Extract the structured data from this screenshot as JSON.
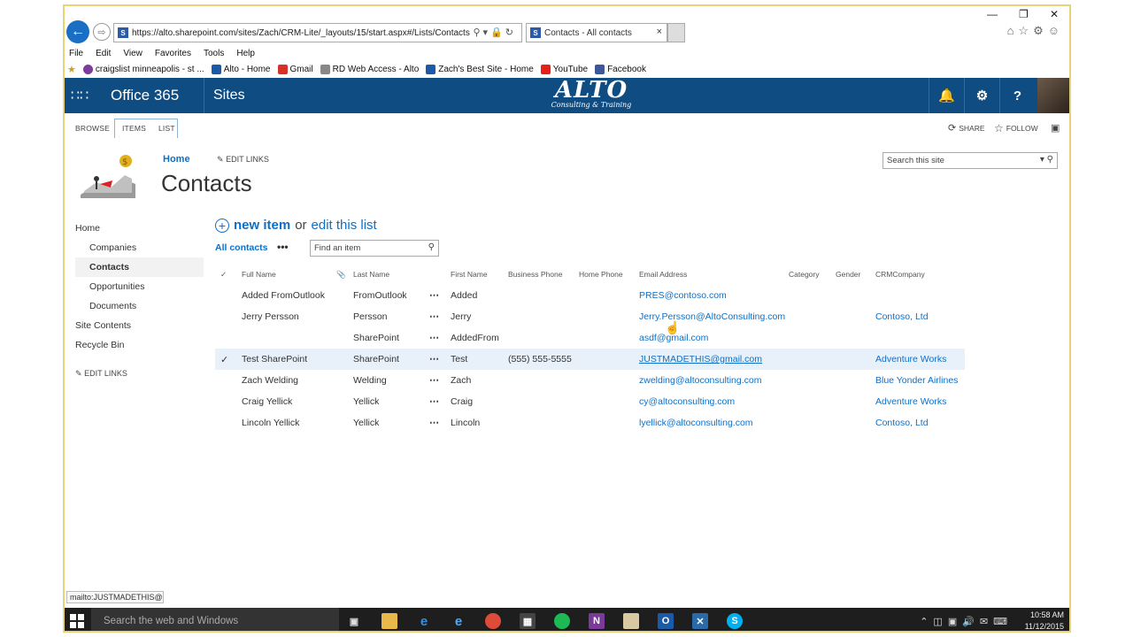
{
  "browser": {
    "url": "https://alto.sharepoint.com/sites/Zach/CRM-Lite/_layouts/15/start.aspx#/Lists/Contacts",
    "tab_title": "Contacts - All contacts",
    "tab_close": "×",
    "menu": [
      "File",
      "Edit",
      "View",
      "Favorites",
      "Tools",
      "Help"
    ],
    "favorites": [
      {
        "label": "craigslist minneapolis - st ...",
        "color": "#7a3e9a"
      },
      {
        "label": "Alto - Home",
        "color": "#1a5aa8"
      },
      {
        "label": "Gmail",
        "color": "#d93025"
      },
      {
        "label": "RD Web Access - Alto",
        "color": "#666666"
      },
      {
        "label": "Zach's Best Site - Home",
        "color": "#1a5aa8"
      },
      {
        "label": "YouTube",
        "color": "#e62117"
      },
      {
        "label": "Facebook",
        "color": "#3b5998"
      }
    ],
    "status_text": "mailto:JUSTMADETHIS@g"
  },
  "suitebar": {
    "brand": "Office 365",
    "sites": "Sites",
    "logo_main": "ALTO",
    "logo_sub": "Consulting & Training",
    "icons": [
      "bell-icon",
      "gear-icon",
      "help-icon"
    ],
    "help_glyph": "?"
  },
  "ribbon": {
    "tabs": [
      "BROWSE",
      "ITEMS",
      "LIST"
    ],
    "share": "SHARE",
    "follow": "FOLLOW"
  },
  "page": {
    "home_link": "Home",
    "edit_links": "EDIT LINKS",
    "title": "Contacts",
    "search_placeholder": "Search this site"
  },
  "leftnav": {
    "home": "Home",
    "companies": "Companies",
    "contacts": "Contacts",
    "opportunities": "Opportunities",
    "documents": "Documents",
    "site_contents": "Site Contents",
    "recycle_bin": "Recycle Bin",
    "edit_links": "EDIT LINKS"
  },
  "list": {
    "new_item": "new item",
    "or": "or",
    "edit_list": "edit this list",
    "view": "All contacts",
    "view_menu": "•••",
    "find_placeholder": "Find an item",
    "columns": [
      "Full Name",
      "Last Name",
      "First Name",
      "Business Phone",
      "Home Phone",
      "Email Address",
      "Category",
      "Gender",
      "CRMCompany"
    ],
    "rows": [
      {
        "full": "Added FromOutlook",
        "last": "FromOutlook",
        "first": "Added",
        "bphone": "",
        "email": "PRES@contoso.com",
        "company": "",
        "selected": false
      },
      {
        "full": "Jerry Persson",
        "last": "Persson",
        "first": "Jerry",
        "bphone": "",
        "email": "Jerry.Persson@AltoConsulting.com",
        "company": "Contoso, Ltd",
        "selected": false
      },
      {
        "full": "",
        "last": "SharePoint",
        "first": "AddedFrom",
        "bphone": "",
        "email": "asdf@gmail.com",
        "company": "",
        "selected": false
      },
      {
        "full": "Test SharePoint",
        "last": "SharePoint",
        "first": "Test",
        "bphone": "(555) 555-5555",
        "email": "JUSTMADETHIS@gmail.com",
        "company": "Adventure Works",
        "selected": true
      },
      {
        "full": "Zach Welding",
        "last": "Welding",
        "first": "Zach",
        "bphone": "",
        "email": "zwelding@altoconsulting.com",
        "company": "Blue Yonder Airlines",
        "selected": false
      },
      {
        "full": "Craig Yellick",
        "last": "Yellick",
        "first": "Craig",
        "bphone": "",
        "email": "cy@altoconsulting.com",
        "company": "Adventure Works",
        "selected": false
      },
      {
        "full": "Lincoln Yellick",
        "last": "Yellick",
        "first": "Lincoln",
        "bphone": "",
        "email": "lyellick@altoconsulting.com",
        "company": "Contoso, Ltd",
        "selected": false
      }
    ]
  },
  "taskbar": {
    "search_placeholder": "Search the web and Windows",
    "time": "10:58 AM",
    "date": "11/12/2015"
  }
}
